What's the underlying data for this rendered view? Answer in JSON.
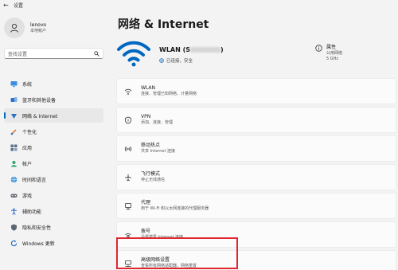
{
  "window": {
    "title": "设置"
  },
  "user": {
    "name": "lenovo",
    "type": "本地帐户"
  },
  "search": {
    "placeholder": "查找设置"
  },
  "nav": [
    {
      "label": "系统",
      "icon": "monitor-icon"
    },
    {
      "label": "蓝牙和其他设备",
      "icon": "bluetooth-icon"
    },
    {
      "label": "网络 & Internet",
      "icon": "network-icon",
      "active": true
    },
    {
      "label": "个性化",
      "icon": "brush-icon"
    },
    {
      "label": "应用",
      "icon": "apps-icon"
    },
    {
      "label": "帐户",
      "icon": "person-icon"
    },
    {
      "label": "时间和语言",
      "icon": "globe-icon"
    },
    {
      "label": "游戏",
      "icon": "gamepad-icon"
    },
    {
      "label": "辅助功能",
      "icon": "accessibility-icon"
    },
    {
      "label": "隐私和安全性",
      "icon": "shield-icon"
    },
    {
      "label": "Windows 更新",
      "icon": "update-icon"
    }
  ],
  "main": {
    "title": "网络 & Internet",
    "network": {
      "name": "WLAN (S",
      "status": "已连接，安全"
    },
    "properties": {
      "title": "属性",
      "line1": "公用网络",
      "line2": "5 GHz"
    },
    "items": [
      {
        "title": "WLAN",
        "desc": "连接、管理已知网络、计量网络",
        "icon": "wifi-icon"
      },
      {
        "title": "VPN",
        "desc": "添加、连接、管理",
        "icon": "vpn-shield-icon"
      },
      {
        "title": "移动热点",
        "desc": "共享 Internet 连接",
        "icon": "hotspot-icon"
      },
      {
        "title": "飞行模式",
        "desc": "停止无线通信",
        "icon": "airplane-icon"
      },
      {
        "title": "代理",
        "desc": "用于 Wi-Fi 和以太网连接的代理服务器",
        "icon": "proxy-icon"
      },
      {
        "title": "拨号",
        "desc": "设置拨号 Internet 连接",
        "icon": "dialup-icon"
      },
      {
        "title": "高级网络设置",
        "desc": "查看所有网络适配器，网络重置",
        "icon": "network-pc-icon"
      }
    ]
  },
  "colors": {
    "accent": "#0067c0",
    "highlight": "#e0262f"
  }
}
